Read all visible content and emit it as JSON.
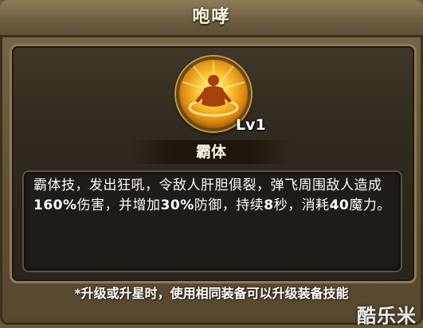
{
  "window": {
    "title": "咆哮"
  },
  "skill": {
    "icon": "roaring-monk-icon",
    "level": "Lv1",
    "name": "霸体",
    "description_parts": [
      {
        "text": "霸体技，发出狂吼，令敌人肝胆俱裂，弹飞周围敌人造成"
      },
      {
        "text": "160%",
        "strong": true
      },
      {
        "text": "伤害，并增加"
      },
      {
        "text": "30%",
        "strong": true
      },
      {
        "text": "防御，持续"
      },
      {
        "text": "8",
        "strong": true
      },
      {
        "text": "秒，消耗"
      },
      {
        "text": "40",
        "strong": true
      },
      {
        "text": "魔力。"
      }
    ]
  },
  "footer": {
    "note": "*升级或升星时，使用相同装备可以升级装备技能"
  },
  "watermark": {
    "text": "酷乐米"
  },
  "colors": {
    "frame": "#6f5f42",
    "inner_panel": "#2f291e",
    "gold_border": "#8f7a52",
    "icon_glow": "#ffcc3a"
  }
}
